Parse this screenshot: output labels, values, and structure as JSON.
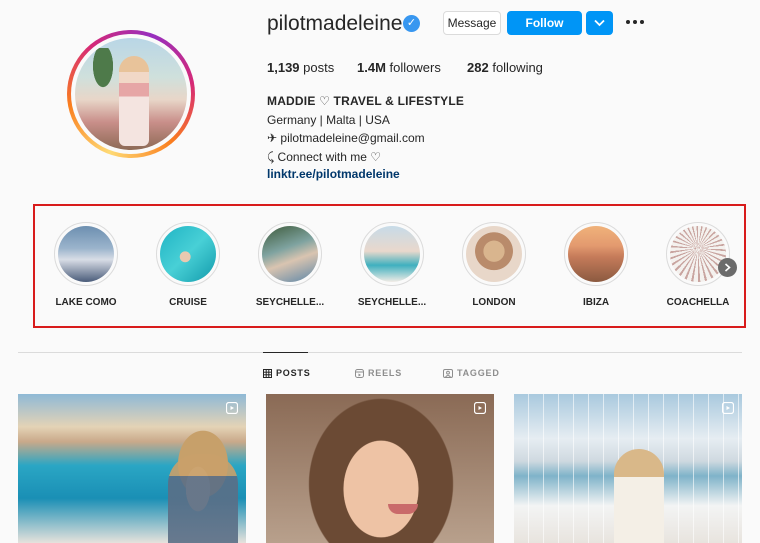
{
  "profile": {
    "username": "pilotmadeleine",
    "verified_symbol": "✓",
    "message_label": "Message",
    "follow_label": "Follow",
    "stats": {
      "posts_count": "1,139",
      "posts_label": "posts",
      "followers_count": "1.4M",
      "followers_label": "followers",
      "following_count": "282",
      "following_label": "following"
    },
    "bio": {
      "name": "MADDIE ♡ TRAVEL & LIFESTYLE",
      "location": "Germany | Malta | USA",
      "email": "✈ pilotmadeleine@gmail.com",
      "connect": "⤹ Connect with me ♡",
      "link": "linktr.ee/pilotmadeleine"
    }
  },
  "highlights": [
    {
      "label": "LAKE COMO"
    },
    {
      "label": "CRUISE"
    },
    {
      "label": "SEYCHELLE..."
    },
    {
      "label": "SEYCHELLE..."
    },
    {
      "label": "LONDON"
    },
    {
      "label": "IBIZA"
    },
    {
      "label": "COACHELLA"
    }
  ],
  "tabs": [
    {
      "label": "POSTS"
    },
    {
      "label": "REELS"
    },
    {
      "label": "TAGGED"
    }
  ],
  "colors": {
    "accent": "#0095f6",
    "highlight_border": "#d81b1b",
    "link": "#00376b",
    "verified": "#3897f0"
  },
  "icons": {
    "verified": "verified-badge-icon",
    "dropdown": "chevron-down-icon",
    "more": "more-options-icon",
    "next": "chevron-right-icon",
    "posts_tab": "grid-icon",
    "reels_tab": "reels-icon",
    "tagged_tab": "tagged-icon",
    "post_type": "reel-icon"
  }
}
